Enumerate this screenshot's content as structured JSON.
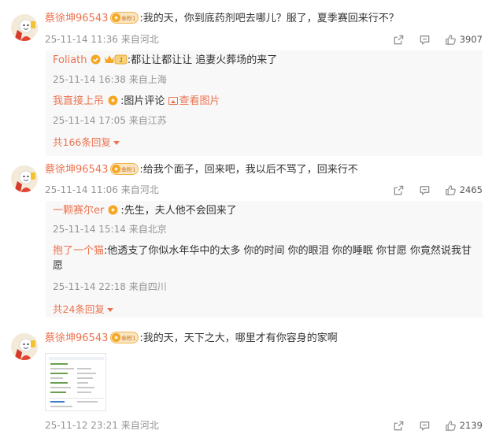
{
  "comments": [
    {
      "username": "蔡徐坤96543",
      "badge": "金粉1",
      "text": ":我的天，你到底药剂吧去哪儿？服了，夏季赛回来行不？",
      "timestamp": "25-11-14 11:36",
      "location": "来自河北",
      "likes": "3907",
      "replies": [
        {
          "username": "Foliath",
          "text": ":都让让都让让 追妻火葬场的来了",
          "timestamp": "25-11-14 16:38",
          "location": "来自上海"
        },
        {
          "username": "我直接上吊",
          "text": ":图片评论",
          "pic_link": "查看图片",
          "timestamp": "25-11-14 17:05",
          "location": "来自江苏"
        }
      ],
      "more_replies": "共166条回复"
    },
    {
      "username": "蔡徐坤96543",
      "badge": "金粉1",
      "text": ":给我个面子，回来吧，我以后不骂了，回来行不",
      "timestamp": "25-11-14 11:06",
      "location": "来自河北",
      "likes": "2465",
      "replies": [
        {
          "username": "一颗赛尔er",
          "text": ":先生，夫人他不会回来了",
          "timestamp": "25-11-14 15:14",
          "location": "来自北京"
        },
        {
          "username": "抱了一个猫",
          "text_line1": ":他透支了你似水年华中的太多  你的时间 你的眼泪 你的睡眠 你甘愿 你竟然说我甘",
          "text_line2": "愿",
          "timestamp": "25-11-14 22:18",
          "location": "来自四川"
        }
      ],
      "more_replies": "共24条回复"
    },
    {
      "username": "蔡徐坤96543",
      "badge": "金粉1",
      "text": ":我的天，天下之大，哪里才有你容身的家啊",
      "timestamp": "25-11-12 23:21",
      "location": "来自河北",
      "likes": "2139"
    }
  ],
  "colors": {
    "username": "#eb7350",
    "meta": "#939393",
    "reply_bg": "#f8f8f8",
    "badge": "#f5a623"
  },
  "icons": [
    "avatar",
    "gold-fan-badge",
    "vip-crown-icon",
    "share-icon",
    "comment-icon",
    "like-icon",
    "picture-icon",
    "chevron-down-icon"
  ]
}
